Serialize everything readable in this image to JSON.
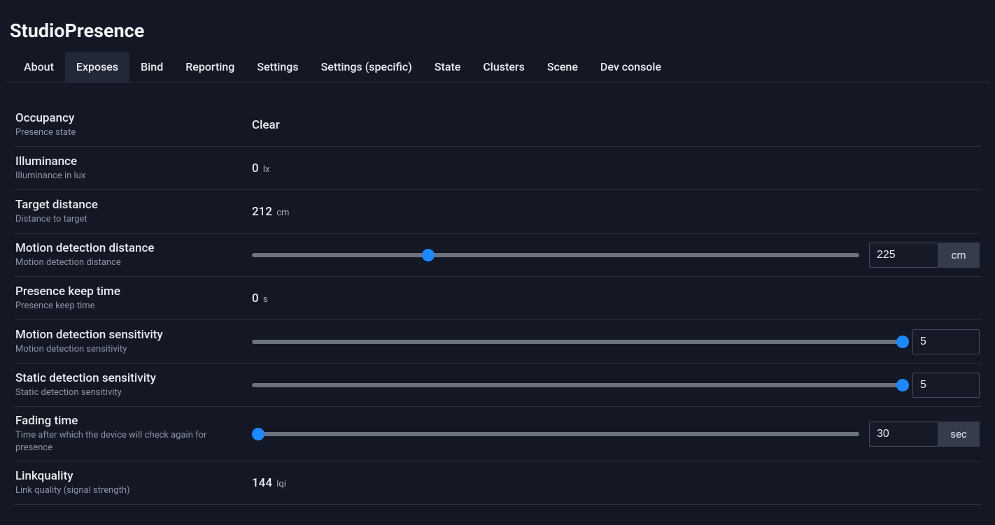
{
  "header": {
    "title": "StudioPresence"
  },
  "tabs": [
    {
      "label": "About",
      "active": false
    },
    {
      "label": "Exposes",
      "active": true
    },
    {
      "label": "Bind",
      "active": false
    },
    {
      "label": "Reporting",
      "active": false
    },
    {
      "label": "Settings",
      "active": false
    },
    {
      "label": "Settings (specific)",
      "active": false
    },
    {
      "label": "State",
      "active": false
    },
    {
      "label": "Clusters",
      "active": false
    },
    {
      "label": "Scene",
      "active": false
    },
    {
      "label": "Dev console",
      "active": false
    }
  ],
  "rows": {
    "occupancy": {
      "title": "Occupancy",
      "desc": "Presence state",
      "value": "Clear"
    },
    "illuminance": {
      "title": "Illuminance",
      "desc": "Illuminance in lux",
      "value": "0",
      "unit": "lx"
    },
    "target_distance": {
      "title": "Target distance",
      "desc": "Distance to target",
      "value": "212",
      "unit": "cm"
    },
    "motion_detection_distance": {
      "title": "Motion detection distance",
      "desc": "Motion detection distance",
      "value": "225",
      "unit": "cm",
      "slider_percent": 29
    },
    "presence_keep_time": {
      "title": "Presence keep time",
      "desc": "Presence keep time",
      "value": "0",
      "unit": "s"
    },
    "motion_detection_sensitivity": {
      "title": "Motion detection sensitivity",
      "desc": "Motion detection sensitivity",
      "value": "5",
      "slider_percent": 100
    },
    "static_detection_sensitivity": {
      "title": "Static detection sensitivity",
      "desc": "Static detection sensitivity",
      "value": "5",
      "slider_percent": 100
    },
    "fading_time": {
      "title": "Fading time",
      "desc": "Time after which the device will check again for presence",
      "value": "30",
      "unit": "sec",
      "slider_percent": 1
    },
    "linkquality": {
      "title": "Linkquality",
      "desc": "Link quality (signal strength)",
      "value": "144",
      "unit": "lqi"
    }
  }
}
